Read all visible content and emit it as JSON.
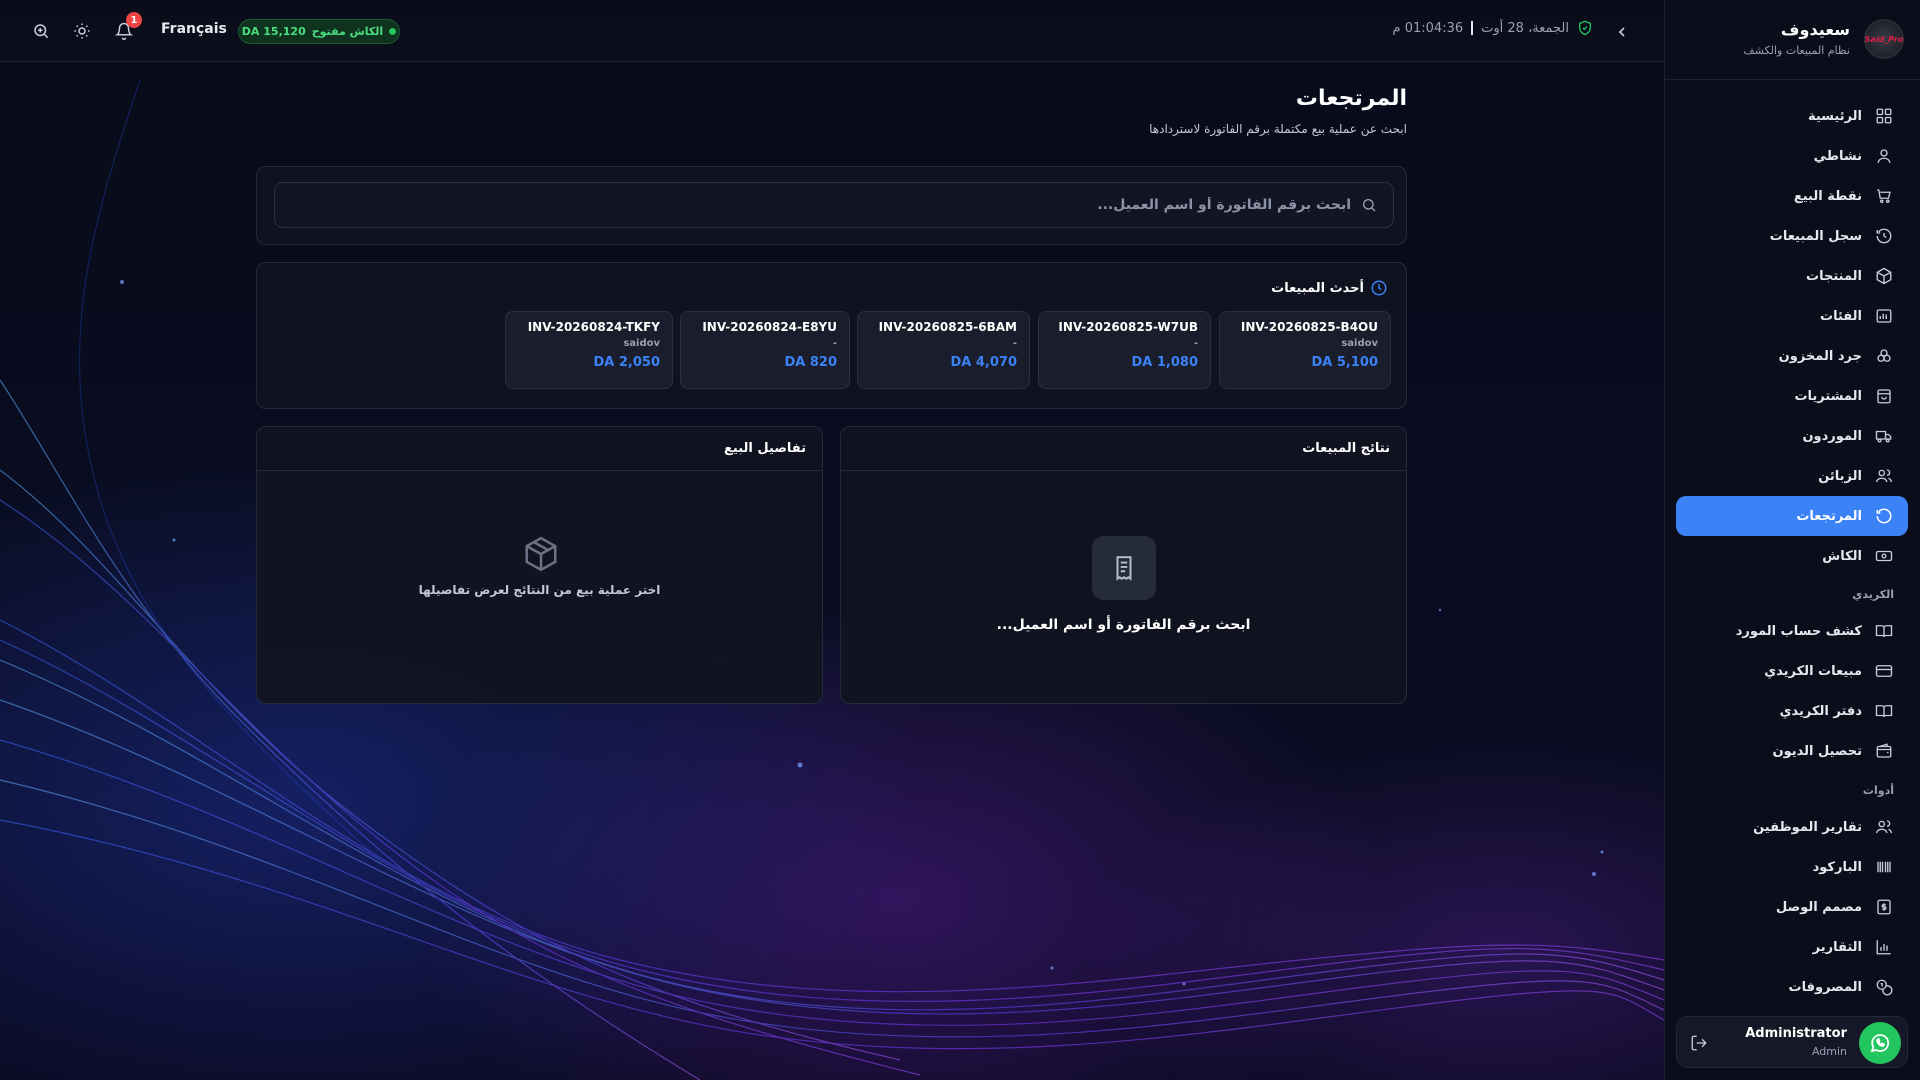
{
  "brand": {
    "name": "سعيدوف",
    "subtitle": "نظام المبيعات والكشف",
    "logo_text": "Said_Pro"
  },
  "topbar": {
    "language_label": "Français",
    "cash_status": "الكاش مفتوح",
    "cash_amount": "DA 15,120",
    "notification_count": "1",
    "date": "الجمعة، 28 أوت",
    "time": "01:04:36 م"
  },
  "nav": {
    "items": [
      {
        "label": "الرئيسية",
        "icon": "grid-icon"
      },
      {
        "label": "نشاطي",
        "icon": "user-icon"
      },
      {
        "label": "نقطة البيع",
        "icon": "cart-icon"
      },
      {
        "label": "سجل المبيعات",
        "icon": "history-icon"
      },
      {
        "label": "المنتجات",
        "icon": "box-icon"
      },
      {
        "label": "الفئات",
        "icon": "chart-icon"
      },
      {
        "label": "جرد المخزون",
        "icon": "boxes-icon"
      },
      {
        "label": "المشتريات",
        "icon": "bag-icon"
      },
      {
        "label": "الموردون",
        "icon": "truck-icon"
      },
      {
        "label": "الزبائن",
        "icon": "users-icon"
      },
      {
        "label": "المرتجعات",
        "icon": "return-icon",
        "active": true
      },
      {
        "label": "الكاش",
        "icon": "cash-icon"
      }
    ],
    "section_credit": "الكريدي",
    "credit_items": [
      {
        "label": "كشف حساب المورد",
        "icon": "book-icon"
      },
      {
        "label": "مبيعات الكريدي",
        "icon": "card-icon"
      },
      {
        "label": "دفتر الكريدي",
        "icon": "book-open-icon"
      },
      {
        "label": "تحصيل الديون",
        "icon": "wallet-icon"
      }
    ],
    "section_tools": "أدوات",
    "tool_items": [
      {
        "label": "تقارير الموظفين",
        "icon": "team-icon"
      },
      {
        "label": "الباركود",
        "icon": "barcode-icon"
      },
      {
        "label": "مصمم الوصل",
        "icon": "receipt-icon"
      },
      {
        "label": "التقارير",
        "icon": "bar-chart-icon"
      },
      {
        "label": "المصروفات",
        "icon": "coins-icon"
      }
    ]
  },
  "user": {
    "name": "Administrator",
    "role": "Admin"
  },
  "page": {
    "title": "المرتجعات",
    "subtitle": "ابحث عن عملية بيع مكتملة برقم الفاتورة لاستردادها",
    "search_placeholder": "ابحث برقم الفاتورة أو اسم العميل..."
  },
  "recent": {
    "title": "أحدث المبيعات",
    "invoices": [
      {
        "number": "INV-20260825-B4OU",
        "customer": "saidov",
        "amount": "DA 5,100"
      },
      {
        "number": "INV-20260825-W7UB",
        "customer": "-",
        "amount": "DA 1,080"
      },
      {
        "number": "INV-20260825-6BAM",
        "customer": "-",
        "amount": "DA 4,070"
      },
      {
        "number": "INV-20260824-E8YU",
        "customer": "-",
        "amount": "DA 820"
      },
      {
        "number": "INV-20260824-TKFY",
        "customer": "saidov",
        "amount": "DA 2,050"
      }
    ]
  },
  "results_panel": {
    "title": "نتائج المبيعات",
    "empty_text": "ابحث برقم الفاتورة أو اسم العميل..."
  },
  "details_panel": {
    "title": "تفاصيل البيع",
    "empty_text": "اختر عملية بيع من النتائج لعرض تفاصيلها"
  },
  "colors": {
    "accent": "#3b82f6",
    "success": "#22c55e",
    "danger": "#ef4444",
    "panel": "#111420",
    "sidebar": "#0b0e1a"
  }
}
